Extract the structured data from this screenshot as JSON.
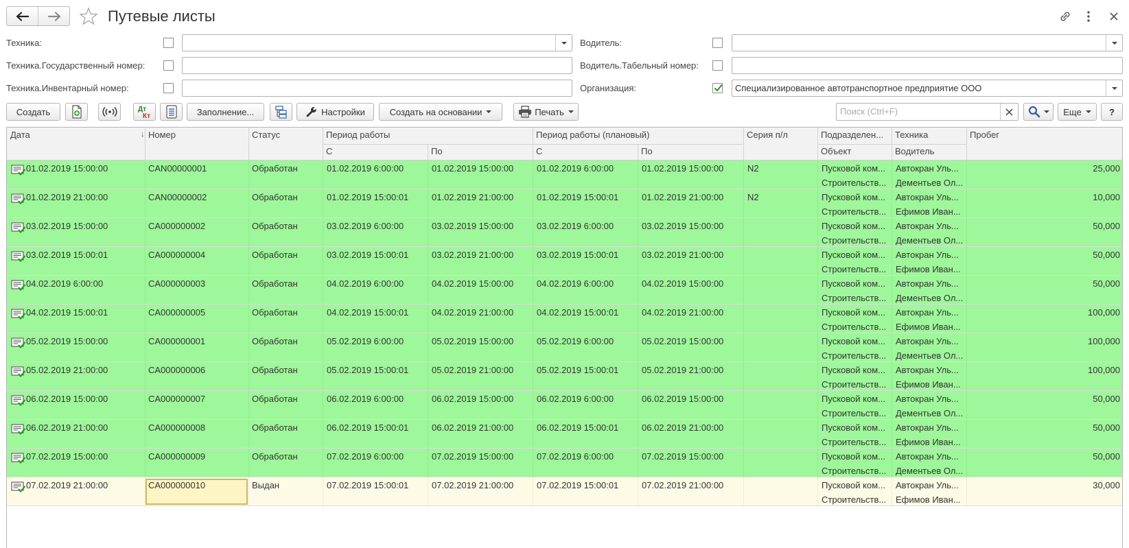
{
  "header": {
    "title": "Путевые листы"
  },
  "filters": {
    "tekhnika_label": "Техника:",
    "tekhnika_gosnomer_label": "Техника.Государственный номер:",
    "tekhnika_invnomer_label": "Техника.Инвентарный номер:",
    "voditel_label": "Водитель:",
    "voditel_tabnomer_label": "Водитель.Табельный номер:",
    "organizaciya_label": "Организация:",
    "organizaciya_value": "Специализированное автотранспортное предприятие ООО",
    "organizaciya_checked": true
  },
  "toolbar": {
    "create_label": "Создать",
    "fill_label": "Заполнение...",
    "settings_label": "Настройки",
    "create_based_label": "Создать на основании",
    "print_label": "Печать",
    "more_label": "Еще",
    "help_label": "?",
    "dt_kt_top": "Дт",
    "dt_kt_bottom": "Кт"
  },
  "search": {
    "placeholder": "Поиск (Ctrl+F)"
  },
  "table": {
    "headers": {
      "date": "Дата",
      "number": "Номер",
      "status": "Статус",
      "period": "Период работы",
      "period_from": "С",
      "period_to": "По",
      "plan_period": "Период работы (плановый)",
      "plan_from": "С",
      "plan_to": "По",
      "series": "Серия п/л",
      "division": "Подразделен...",
      "object": "Объект",
      "vehicle": "Техника",
      "driver": "Водитель",
      "mileage": "Пробег"
    },
    "rows": [
      {
        "date": "01.02.2019 15:00:00",
        "number": "CAN00000001",
        "status": "Обработан",
        "from": "01.02.2019 6:00:00",
        "to": "01.02.2019 15:00:00",
        "plan_from": "01.02.2019 6:00:00",
        "plan_to": "01.02.2019 15:00:00",
        "series": "N2",
        "division": "Пусковой ком...",
        "object": "Строительств...",
        "vehicle": "Автокран Уль...",
        "driver": "Дементьев Ол...",
        "mileage": "25,000"
      },
      {
        "date": "01.02.2019 21:00:00",
        "number": "CAN00000002",
        "status": "Обработан",
        "from": "01.02.2019 15:00:01",
        "to": "01.02.2019 21:00:00",
        "plan_from": "01.02.2019 15:00:01",
        "plan_to": "01.02.2019 21:00:00",
        "series": "N2",
        "division": "Пусковой ком...",
        "object": "Строительств...",
        "vehicle": "Автокран Уль...",
        "driver": "Ефимов Иван...",
        "mileage": "10,000"
      },
      {
        "date": "03.02.2019 15:00:00",
        "number": "CA000000002",
        "status": "Обработан",
        "from": "03.02.2019 6:00:00",
        "to": "03.02.2019 15:00:00",
        "plan_from": "03.02.2019 6:00:00",
        "plan_to": "03.02.2019 15:00:00",
        "series": "",
        "division": "Пусковой ком...",
        "object": "Строительств...",
        "vehicle": "Автокран Уль...",
        "driver": "Дементьев Ол...",
        "mileage": "50,000"
      },
      {
        "date": "03.02.2019 15:00:01",
        "number": "CA000000004",
        "status": "Обработан",
        "from": "03.02.2019 15:00:01",
        "to": "03.02.2019 21:00:00",
        "plan_from": "03.02.2019 15:00:01",
        "plan_to": "03.02.2019 21:00:00",
        "series": "",
        "division": "Пусковой ком...",
        "object": "Строительств...",
        "vehicle": "Автокран Уль...",
        "driver": "Ефимов Иван...",
        "mileage": "50,000"
      },
      {
        "date": "04.02.2019 6:00:00",
        "number": "CA000000003",
        "status": "Обработан",
        "from": "04.02.2019 6:00:00",
        "to": "04.02.2019 15:00:00",
        "plan_from": "04.02.2019 6:00:00",
        "plan_to": "04.02.2019 15:00:00",
        "series": "",
        "division": "Пусковой ком...",
        "object": "Строительств...",
        "vehicle": "Автокран Уль...",
        "driver": "Дементьев Ол...",
        "mileage": "50,000"
      },
      {
        "date": "04.02.2019 15:00:01",
        "number": "CA000000005",
        "status": "Обработан",
        "from": "04.02.2019 15:00:01",
        "to": "04.02.2019 21:00:00",
        "plan_from": "04.02.2019 15:00:01",
        "plan_to": "04.02.2019 21:00:00",
        "series": "",
        "division": "Пусковой ком...",
        "object": "Строительств...",
        "vehicle": "Автокран Уль...",
        "driver": "Ефимов Иван...",
        "mileage": "100,000"
      },
      {
        "date": "05.02.2019 15:00:00",
        "number": "CA000000001",
        "status": "Обработан",
        "from": "05.02.2019 6:00:00",
        "to": "05.02.2019 15:00:00",
        "plan_from": "05.02.2019 6:00:00",
        "plan_to": "05.02.2019 15:00:00",
        "series": "",
        "division": "Пусковой ком...",
        "object": "Строительств...",
        "vehicle": "Автокран Уль...",
        "driver": "Дементьев Ол...",
        "mileage": "100,000"
      },
      {
        "date": "05.02.2019 21:00:00",
        "number": "CA000000006",
        "status": "Обработан",
        "from": "05.02.2019 15:00:01",
        "to": "05.02.2019 21:00:00",
        "plan_from": "05.02.2019 15:00:01",
        "plan_to": "05.02.2019 21:00:00",
        "series": "",
        "division": "Пусковой ком...",
        "object": "Строительств...",
        "vehicle": "Автокран Уль...",
        "driver": "Ефимов Иван...",
        "mileage": "100,000"
      },
      {
        "date": "06.02.2019 15:00:00",
        "number": "CA000000007",
        "status": "Обработан",
        "from": "06.02.2019 6:00:00",
        "to": "06.02.2019 15:00:00",
        "plan_from": "06.02.2019 6:00:00",
        "plan_to": "06.02.2019 15:00:00",
        "series": "",
        "division": "Пусковой ком...",
        "object": "Строительств...",
        "vehicle": "Автокран Уль...",
        "driver": "Дементьев Ол...",
        "mileage": "50,000"
      },
      {
        "date": "06.02.2019 21:00:00",
        "number": "CA000000008",
        "status": "Обработан",
        "from": "06.02.2019 15:00:01",
        "to": "06.02.2019 21:00:00",
        "plan_from": "06.02.2019 15:00:01",
        "plan_to": "06.02.2019 21:00:00",
        "series": "",
        "division": "Пусковой ком...",
        "object": "Строительств...",
        "vehicle": "Автокран Уль...",
        "driver": "Ефимов Иван...",
        "mileage": "50,000"
      },
      {
        "date": "07.02.2019 15:00:00",
        "number": "CA000000009",
        "status": "Обработан",
        "from": "07.02.2019 6:00:00",
        "to": "07.02.2019 15:00:00",
        "plan_from": "07.02.2019 6:00:00",
        "plan_to": "07.02.2019 15:00:00",
        "series": "",
        "division": "Пусковой ком...",
        "object": "Строительств...",
        "vehicle": "Автокран Уль...",
        "driver": "Дементьев Ол...",
        "mileage": "50,000"
      },
      {
        "date": "07.02.2019 21:00:00",
        "number": "CA000000010",
        "status": "Выдан",
        "from": "07.02.2019 15:00:01",
        "to": "07.02.2019 21:00:00",
        "plan_from": "07.02.2019 15:00:01",
        "plan_to": "07.02.2019 21:00:00",
        "series": "",
        "division": "Пусковой ком...",
        "object": "Строительств...",
        "vehicle": "Автокран Уль...",
        "driver": "Ефимов Иван...",
        "mileage": "30,000",
        "current": true
      }
    ]
  },
  "colors": {
    "processed_row": "#9ef79a",
    "issued_row": "#fdfae6",
    "focus_border": "#c9b76a"
  },
  "icons": {
    "back": "arrow-left-icon",
    "forward": "arrow-right-icon",
    "favorite": "star-icon",
    "link": "link-icon",
    "menu": "kebab-menu-icon",
    "close": "close-icon",
    "document": "document-check-icon"
  }
}
